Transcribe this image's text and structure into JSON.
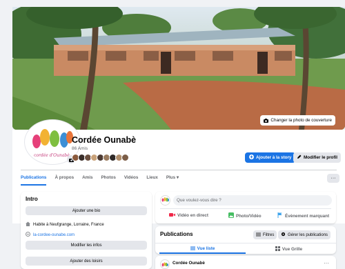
{
  "cover": {
    "button_label": "Changer la photo de couverture"
  },
  "profile": {
    "name": "Cordée Ounabè",
    "friends": "86 Amis",
    "friend_avatar_colors": [
      "#8b5a3c",
      "#3a2e2a",
      "#6b4f3f",
      "#c9a27a",
      "#4d3b33",
      "#9a7b5f",
      "#2f2a28",
      "#b08e6c",
      "#7c5e48"
    ]
  },
  "actions": {
    "story_label": "Ajouter à la story",
    "edit_label": "Modifier le profil",
    "more_label": "···"
  },
  "tabs": [
    {
      "label": "Publications",
      "active": true
    },
    {
      "label": "À propos",
      "active": false
    },
    {
      "label": "Amis",
      "active": false
    },
    {
      "label": "Photos",
      "active": false
    },
    {
      "label": "Vidéos",
      "active": false
    },
    {
      "label": "Lieux",
      "active": false
    },
    {
      "label": "Plus ▾",
      "active": false
    }
  ],
  "intro": {
    "title": "Intro",
    "add_bio": "Ajouter une bio",
    "location": "Habite à Neufgrange, Lorraine, France",
    "website": "la-cordee-ounabe.com",
    "edit_info": "Modifier les infos",
    "add_hobbies": "Ajouter des loisirs"
  },
  "composer": {
    "placeholder": "Que voulez-vous dire ?",
    "live_video": "Vidéo en direct",
    "photo_video": "Photo/Vidéo",
    "life_event": "Évènement marquant"
  },
  "posts": {
    "title": "Publications",
    "filters": "Filtres",
    "manage": "Gérer les publications",
    "list_view": "Vue liste",
    "grid_view": "Vue Grille"
  },
  "post": {
    "author": "Cordée Ounabè",
    "more": "···"
  },
  "colors": {
    "accent": "#1b74e4",
    "live_red": "#f02849",
    "photo_green": "#45bd62",
    "event_blue": "#3ea4ec"
  },
  "logo_text": "cordée d'Ounabè"
}
